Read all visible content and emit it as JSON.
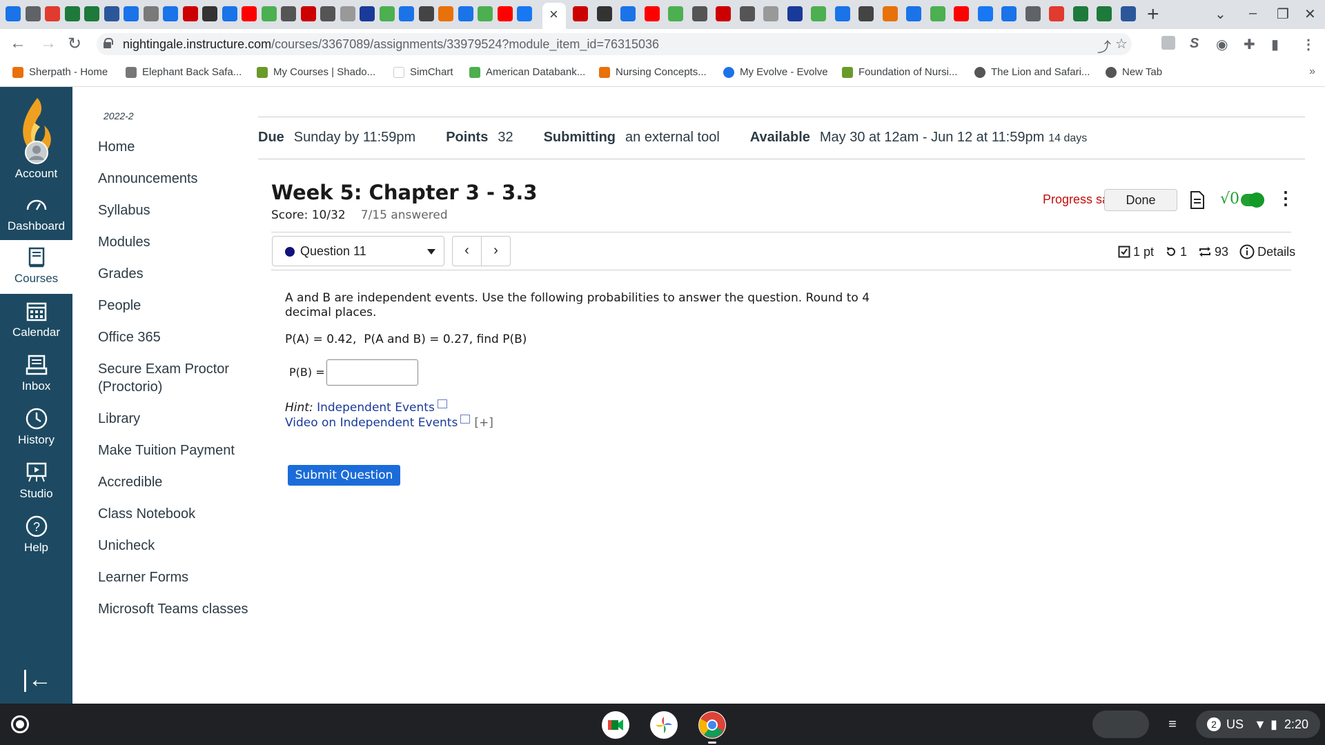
{
  "browser": {
    "tab_close": "×",
    "new_tab": "+",
    "win_controls": [
      "⌄",
      "–",
      "❐",
      "✕"
    ],
    "url_host": "nightingale.instructure.com",
    "url_path": "/courses/3367089/assignments/33979524?module_item_id=76315036",
    "bookmarks": [
      "Sherpath - Home",
      "Elephant Back Safa...",
      "My Courses | Shado...",
      "SimChart",
      "American Databank...",
      "Nursing Concepts...",
      "My Evolve - Evolve",
      "Foundation of Nursi...",
      "The Lion and Safari...",
      "New Tab"
    ],
    "bookmarks_more": "»",
    "bookmark_colors": [
      "#e8710a",
      "#777777",
      "#6a9a2a",
      "#ffffff",
      "#4caf50",
      "#e8710a",
      "#1a73e8",
      "#6a9a2a",
      "#555555",
      "#555555"
    ],
    "tab_icon_colors": [
      "#1a73e8",
      "#5f6368",
      "#e03b2e",
      "#1d7a3a",
      "#1d7a3a",
      "#2b579a",
      "#1a73e8",
      "#7a7a7a",
      "#1a73e8",
      "#cc0000",
      "#333333",
      "#1a73e8",
      "#ff0000",
      "#4caf50",
      "#555555",
      "#cc0000",
      "#555555",
      "#999999",
      "#1a3a9a",
      "#4caf50",
      "#1a73e8",
      "#444444",
      "#e8710a",
      "#1a73e8",
      "#4caf50",
      "#ff0000",
      "#1877f2"
    ]
  },
  "gnav": {
    "items": [
      {
        "label": "Account"
      },
      {
        "label": "Dashboard"
      },
      {
        "label": "Courses"
      },
      {
        "label": "Calendar"
      },
      {
        "label": "Inbox"
      },
      {
        "label": "History"
      },
      {
        "label": "Studio"
      },
      {
        "label": "Help"
      }
    ],
    "collapse": "|←"
  },
  "course": {
    "term": "2022-2",
    "nav": [
      "Home",
      "Announcements",
      "Syllabus",
      "Modules",
      "Grades",
      "People",
      "Office 365",
      "Secure Exam Proctor (Proctorio)",
      "Library",
      "Make Tuition Payment",
      "Accredible",
      "Class Notebook",
      "Unicheck",
      "Learner Forms",
      "Microsoft Teams classes"
    ]
  },
  "assignment": {
    "due_label": "Due",
    "due_value": "Sunday by 11:59pm",
    "points_label": "Points",
    "points_value": "32",
    "submitting_label": "Submitting",
    "submitting_value": "an external tool",
    "available_label": "Available",
    "available_value": "May 30 at 12am - Jun 12 at 11:59pm",
    "available_days": "14 days"
  },
  "quiz": {
    "title": "Week 5: Chapter 3 - 3.3",
    "score": "Score: 10/32",
    "answered": "7/15 answered",
    "progress_saved": "Progress saved",
    "done_label": "Done",
    "sqrt_label": "√0",
    "kebab": "⋮",
    "question_select": "Question 11",
    "prev": "‹",
    "next": "›",
    "points": "1 pt",
    "retries": "1",
    "attempts": "93",
    "details": "Details",
    "text": "A and B are independent events. Use the following probabilities to answer the question. Round to 4 decimal places.",
    "given": "P(A) = 0.42,  P(A and B) = 0.27, find P(B)",
    "answer_label": "P(B) =",
    "answer_value": "",
    "hint_label": "Hint:",
    "hint_link": "Independent Events",
    "video_link": "Video on Independent Events",
    "expand": "[+]",
    "submit": "Submit Question"
  },
  "shelf": {
    "tray_count": "2",
    "tray_locale": "US",
    "time": "2:20"
  }
}
